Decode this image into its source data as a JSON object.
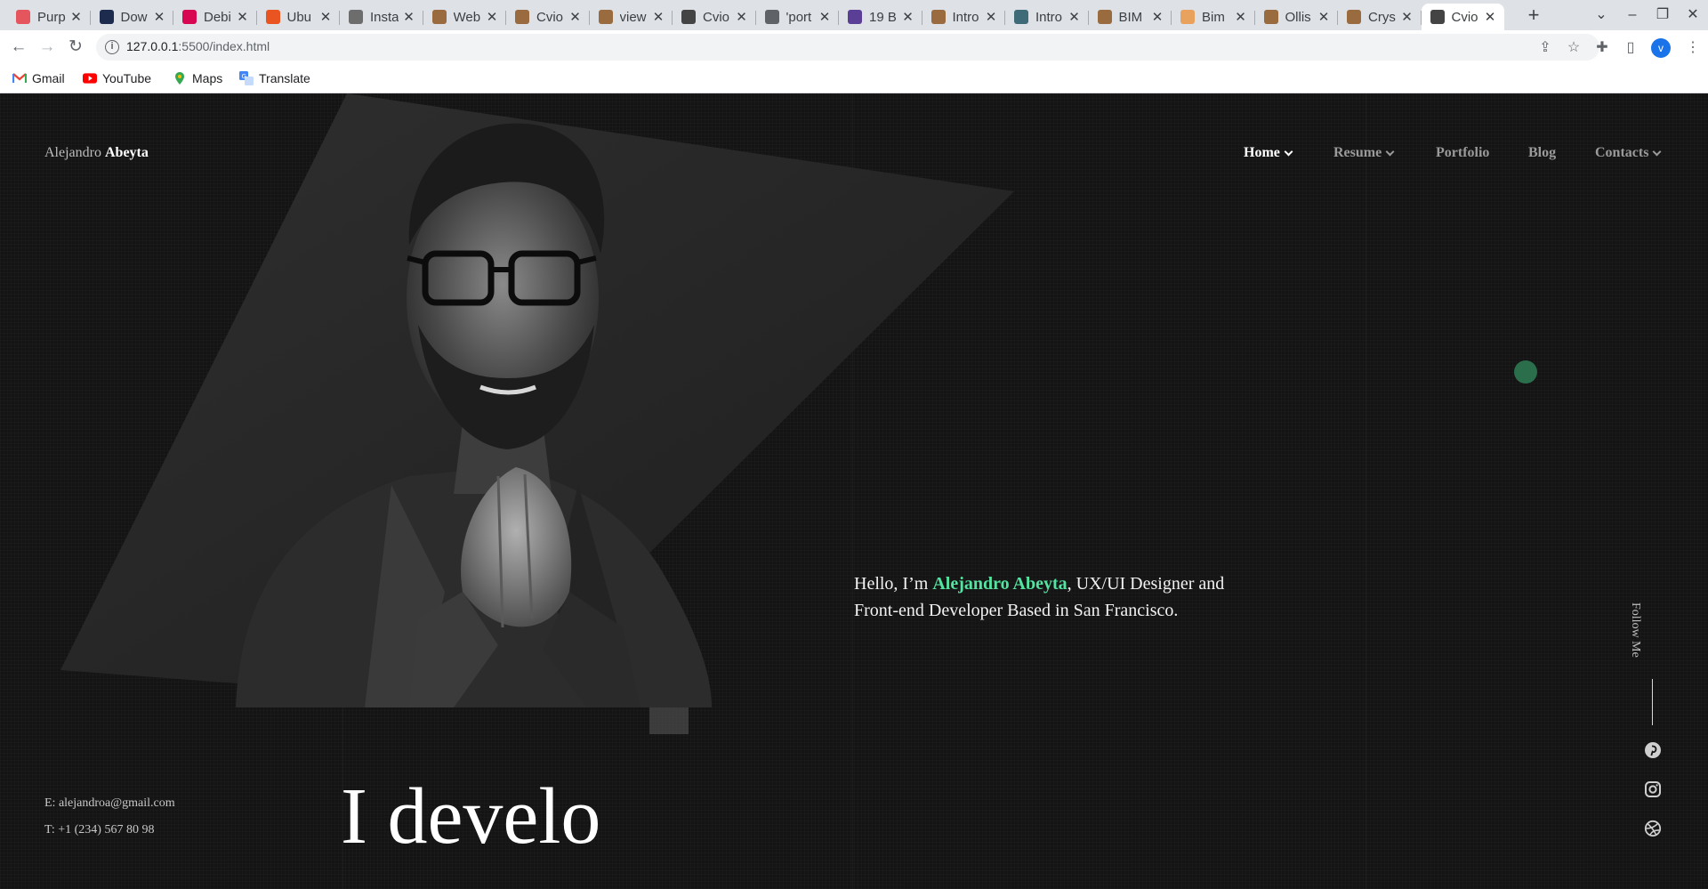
{
  "browser": {
    "tabs": [
      {
        "label": "Purp",
        "favicon": "figma-icon",
        "color": "#e4555d"
      },
      {
        "label": "Dow",
        "favicon": "h-icon",
        "color": "#1d2b4f"
      },
      {
        "label": "Debi",
        "favicon": "debian-icon",
        "color": "#d70751"
      },
      {
        "label": "Ubu",
        "favicon": "ubuntu-icon",
        "color": "#e95420"
      },
      {
        "label": "Insta",
        "favicon": "mail-icon",
        "color": "#6d6d6d"
      },
      {
        "label": "Web",
        "favicon": "doc-icon",
        "color": "#9a6b3e"
      },
      {
        "label": "Cvio",
        "favicon": "doc-icon",
        "color": "#9a6b3e"
      },
      {
        "label": "view",
        "favicon": "doc-icon",
        "color": "#9a6b3e"
      },
      {
        "label": "Cvio",
        "favicon": "grid-icon",
        "color": "#444444"
      },
      {
        "label": "'port",
        "favicon": "globe-icon",
        "color": "#5f6368"
      },
      {
        "label": "19 B",
        "favicon": "square-icon",
        "color": "#5b3e96"
      },
      {
        "label": "Intro",
        "favicon": "doc-icon",
        "color": "#9a6b3e"
      },
      {
        "label": "Intro",
        "favicon": "phone-icon",
        "color": "#3f6b78"
      },
      {
        "label": "BIM",
        "favicon": "doc-icon",
        "color": "#9a6b3e"
      },
      {
        "label": "Bim",
        "favicon": "circle-icon",
        "color": "#e8a25e"
      },
      {
        "label": "Ollis",
        "favicon": "doc-icon",
        "color": "#9a6b3e"
      },
      {
        "label": "Crys",
        "favicon": "doc-icon",
        "color": "#9a6b3e"
      },
      {
        "label": "Cvio",
        "favicon": "grid-icon",
        "color": "#444444",
        "active": true
      }
    ],
    "url_host": "127.0.0.1",
    "url_path": ":5500/index.html",
    "profile_initial": "v",
    "bookmarks": [
      "Gmail",
      "YouTube",
      "Maps",
      "Translate"
    ]
  },
  "site": {
    "logo_first": "Alejandro",
    "logo_last": "Abeyta",
    "nav": [
      {
        "label": "Home",
        "dropdown": true,
        "active": true
      },
      {
        "label": "Resume",
        "dropdown": true
      },
      {
        "label": "Portfolio",
        "dropdown": false
      },
      {
        "label": "Blog",
        "dropdown": false
      },
      {
        "label": "Contacts",
        "dropdown": true
      }
    ],
    "intro_prefix": "Hello, I’m ",
    "intro_name": "Alejandro Abeyta",
    "intro_suffix": ", UX/UI Designer and Front-end Developer Based in San Francisco.",
    "follow_label": "Follow Me",
    "social": [
      "pinterest-icon",
      "instagram-icon",
      "dribbble-icon"
    ],
    "email": "E: alejandroa@gmail.com",
    "phone": "T: +1 (234) 567 80 98",
    "typed_text": "I develo",
    "accent_color": "#54e3a1"
  }
}
